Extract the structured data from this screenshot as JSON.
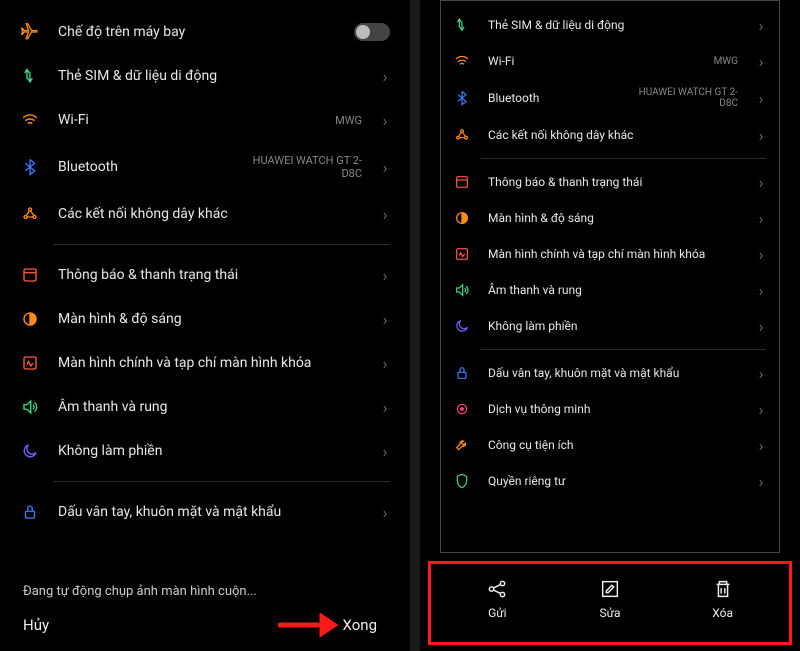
{
  "left": {
    "rows": [
      {
        "icon": "airplane",
        "color": "#ff8c1a",
        "label": "Chế độ trên máy bay",
        "toggle": true
      },
      {
        "icon": "sim",
        "color": "#3dd88a",
        "label": "Thẻ SIM & dữ liệu di động",
        "chevron": true
      },
      {
        "icon": "wifi",
        "color": "#ff8c1a",
        "label": "Wi-Fi",
        "value": "MWG",
        "chevron": true
      },
      {
        "icon": "bluetooth",
        "color": "#3d7cff",
        "label": "Bluetooth",
        "value": "HUAWEI WATCH GT 2-D8C",
        "chevron": true
      },
      {
        "icon": "wireless",
        "color": "#ff8c1a",
        "label": "Các kết nối không dây khác",
        "chevron": true
      },
      {
        "divider": true
      },
      {
        "icon": "notify",
        "color": "#ff5c3d",
        "label": "Thông báo & thanh trạng thái",
        "chevron": true
      },
      {
        "icon": "brightness",
        "color": "#ff8c1a",
        "label": "Màn hình & độ sáng",
        "chevron": true
      },
      {
        "icon": "home",
        "color": "#ff5c3d",
        "label": "Màn hình chính và tạp chí màn hình khóa",
        "chevron": true
      },
      {
        "icon": "sound",
        "color": "#3dd88a",
        "label": "Âm thanh và rung",
        "chevron": true
      },
      {
        "icon": "dnd",
        "color": "#7a5cff",
        "label": "Không làm phiền",
        "chevron": true
      },
      {
        "divider": true
      },
      {
        "icon": "lock",
        "color": "#3d7cff",
        "label": "Dấu vân tay, khuôn mặt và mật khẩu",
        "chevron": true
      }
    ],
    "status": "Đang tự động chụp ảnh màn hình cuộn...",
    "cancel": "Hủy",
    "done": "Xong"
  },
  "right": {
    "rows": [
      {
        "icon": "sim",
        "color": "#3dd88a",
        "label": "Thẻ SIM & dữ liệu di động",
        "chevron": true
      },
      {
        "icon": "wifi",
        "color": "#ff8c1a",
        "label": "Wi-Fi",
        "value": "MWG",
        "chevron": true
      },
      {
        "icon": "bluetooth",
        "color": "#3d7cff",
        "label": "Bluetooth",
        "value": "HUAWEI WATCH GT 2-D8C",
        "chevron": true
      },
      {
        "icon": "wireless",
        "color": "#ff8c1a",
        "label": "Các kết nối không dây khác",
        "chevron": true
      },
      {
        "divider": true
      },
      {
        "icon": "notify",
        "color": "#ff5c3d",
        "label": "Thông báo & thanh trạng thái",
        "chevron": true
      },
      {
        "icon": "brightness",
        "color": "#ff8c1a",
        "label": "Màn hình & độ sáng",
        "chevron": true
      },
      {
        "icon": "home",
        "color": "#ff5c3d",
        "label": "Màn hình chính và tạp chí màn hình khóa",
        "chevron": true
      },
      {
        "icon": "sound",
        "color": "#3dd88a",
        "label": "Âm thanh và rung",
        "chevron": true
      },
      {
        "icon": "dnd",
        "color": "#7a5cff",
        "label": "Không làm phiền",
        "chevron": true
      },
      {
        "divider": true
      },
      {
        "icon": "lock",
        "color": "#3d7cff",
        "label": "Dấu vân tay, khuôn mặt và mật khẩu",
        "chevron": true
      },
      {
        "icon": "smart",
        "color": "#ff3d7a",
        "label": "Dịch vụ thông minh",
        "chevron": true
      },
      {
        "icon": "tool",
        "color": "#ff8c1a",
        "label": "Công cụ tiện ích",
        "chevron": true
      },
      {
        "icon": "privacy",
        "color": "#3dd88a",
        "label": "Quyền riêng tư",
        "chevron": true
      }
    ],
    "actions": {
      "send": "Gửi",
      "edit": "Sửa",
      "delete": "Xóa"
    }
  }
}
